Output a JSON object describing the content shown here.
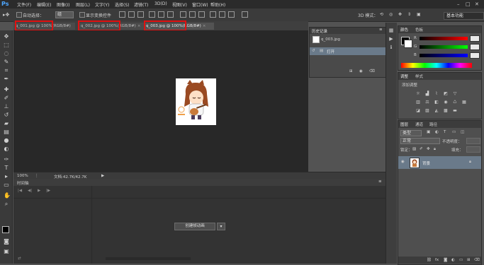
{
  "app": {
    "logo": "Ps"
  },
  "menu": [
    "文件(F)",
    "编辑(E)",
    "图像(I)",
    "图层(L)",
    "文字(Y)",
    "选择(S)",
    "滤镜(T)",
    "3D(D)",
    "视图(V)",
    "窗口(W)",
    "帮助(H)"
  ],
  "options": {
    "auto_select_label": "自动选择：",
    "auto_select_value": "组",
    "show_transform_label": "显示变换控件",
    "mode_3d_label": "3D 模式：",
    "workspace": "基本功能"
  },
  "doc_tabs": [
    {
      "label": "q_001.jpg @ 100%(RGB/8#)"
    },
    {
      "label": "q_002.jpg @ 100%(RGB/8#)"
    },
    {
      "label": "q_003.jpg @ 100%(RGB/8#)"
    }
  ],
  "status": {
    "zoom": "100%",
    "doc_size": "文档:42.7K/42.7K"
  },
  "timeline": {
    "tab": "时间轴",
    "create_button": "创建帧动画"
  },
  "history": {
    "tab": "历史记录",
    "snapshot": "q_003.jpg",
    "step": "打开"
  },
  "color_panel": {
    "tabs": [
      "颜色",
      "色板"
    ],
    "channels": [
      "R",
      "G",
      "B"
    ]
  },
  "adjust_panel": {
    "tabs": [
      "调整",
      "样式"
    ],
    "title": "添加调整"
  },
  "layers_panel": {
    "tabs": [
      "图层",
      "通道",
      "路径"
    ],
    "kind_label": "类型",
    "blend_mode": "正常",
    "opacity_label": "不透明度：",
    "lock_label": "锁定：",
    "fill_label": "填充：",
    "layer_name": "背景"
  },
  "colors": {
    "highlight": "#e01010",
    "ps_blue": "#4ea6ff"
  }
}
